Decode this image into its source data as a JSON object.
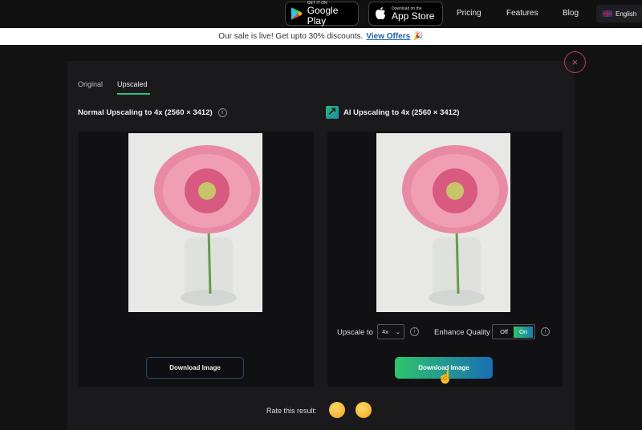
{
  "topbar": {
    "google_play": {
      "small": "GET IT ON",
      "big": "Google Play"
    },
    "app_store": {
      "small": "Download on the",
      "big": "App Store"
    },
    "nav": [
      "Pricing",
      "Features",
      "Blog"
    ],
    "language": "English"
  },
  "banner": {
    "text": "Our sale is live! Get upto 30% discounts.",
    "link": "View Offers",
    "emoji": "🎉"
  },
  "modal": {
    "close": "×",
    "tabs": [
      {
        "label": "Original",
        "active": false
      },
      {
        "label": "Upscaled",
        "active": true
      }
    ],
    "left": {
      "title": "Normal Upscaling to 4x (2560 × 3412)",
      "info": "i",
      "download": "Download Image"
    },
    "right": {
      "title": "AI Upscaling to 4x (2560 × 3412)",
      "upscale_label": "Upscale to",
      "upscale_value": "4x",
      "enhance_label": "Enhance Quality",
      "toggle_off": "Off",
      "toggle_on": "On",
      "toggle_state": "On",
      "info": "i",
      "download": "Download Image"
    },
    "rate_label": "Rate this result:",
    "rate_options": [
      "😔",
      "😀"
    ]
  },
  "colors": {
    "accent_green": "#2ec46c",
    "accent_blue": "#1a6fb3",
    "close_red": "#c23a5a"
  }
}
